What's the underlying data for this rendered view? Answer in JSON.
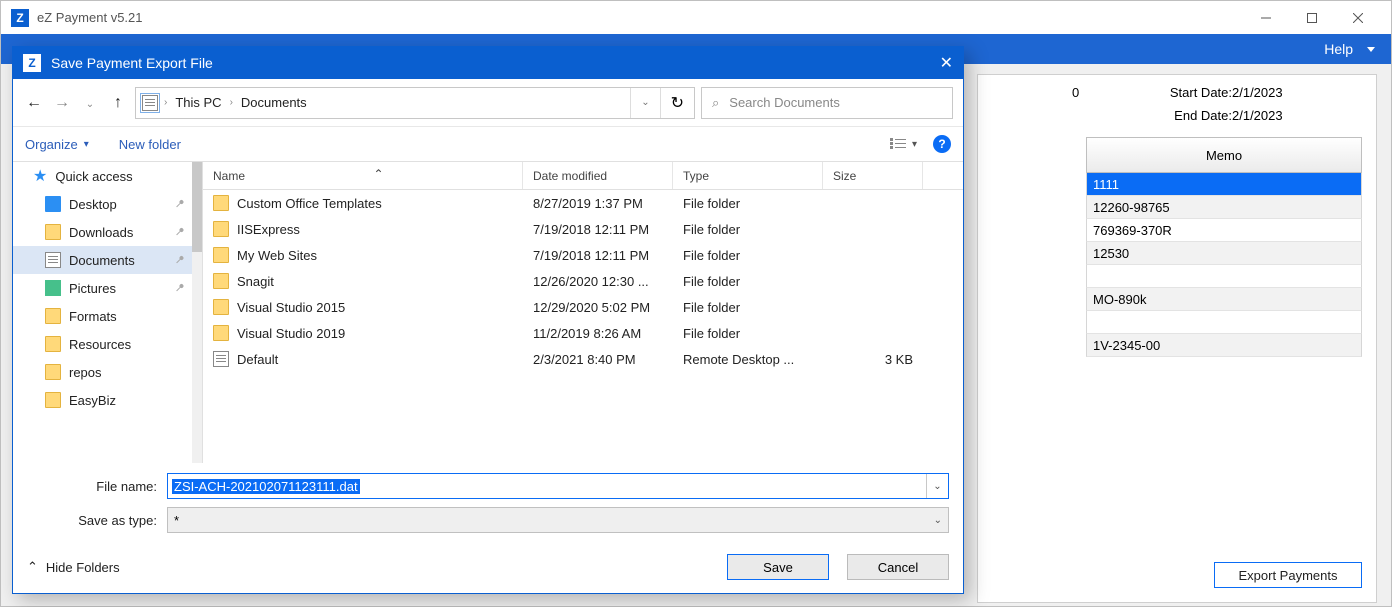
{
  "app": {
    "title": "eZ Payment v5.21",
    "menu": {
      "help": "Help"
    }
  },
  "right": {
    "zero": "0",
    "start_label": "Start Date:",
    "start_value": "2/1/2023",
    "end_label": "End Date:",
    "end_value": "2/1/2023",
    "memo_header": "Memo",
    "rows": [
      "1111",
      "12260-98765",
      "769369-370R",
      "12530",
      "",
      "MO-890k",
      "",
      "1V-2345-00"
    ],
    "export_label": "Export Payments"
  },
  "dialog": {
    "title": "Save Payment Export File",
    "breadcrumb": {
      "root": "This PC",
      "leaf": "Documents"
    },
    "search_placeholder": "Search Documents",
    "toolbar": {
      "organize": "Organize",
      "newfolder": "New folder"
    },
    "tree": {
      "quick": "Quick access",
      "items": [
        {
          "label": "Desktop",
          "icon": "desk",
          "pin": true
        },
        {
          "label": "Downloads",
          "icon": "dl",
          "pin": true
        },
        {
          "label": "Documents",
          "icon": "doc",
          "pin": true,
          "sel": true
        },
        {
          "label": "Pictures",
          "icon": "pic",
          "pin": true
        },
        {
          "label": "Formats",
          "icon": "folder"
        },
        {
          "label": "Resources",
          "icon": "folder"
        },
        {
          "label": "repos",
          "icon": "folder"
        },
        {
          "label": "EasyBiz",
          "icon": "folder"
        }
      ]
    },
    "columns": {
      "name": "Name",
      "date": "Date modified",
      "type": "Type",
      "size": "Size"
    },
    "files": [
      {
        "name": "Custom Office Templates",
        "date": "8/27/2019 1:37 PM",
        "type": "File folder",
        "size": "",
        "icon": "folder"
      },
      {
        "name": "IISExpress",
        "date": "7/19/2018 12:11 PM",
        "type": "File folder",
        "size": "",
        "icon": "folder"
      },
      {
        "name": "My Web Sites",
        "date": "7/19/2018 12:11 PM",
        "type": "File folder",
        "size": "",
        "icon": "folder"
      },
      {
        "name": "Snagit",
        "date": "12/26/2020 12:30 ...",
        "type": "File folder",
        "size": "",
        "icon": "folder"
      },
      {
        "name": "Visual Studio 2015",
        "date": "12/29/2020 5:02 PM",
        "type": "File folder",
        "size": "",
        "icon": "folder"
      },
      {
        "name": "Visual Studio 2019",
        "date": "11/2/2019 8:26 AM",
        "type": "File folder",
        "size": "",
        "icon": "folder"
      },
      {
        "name": "Default",
        "date": "2/3/2021 8:40 PM",
        "type": "Remote Desktop ...",
        "size": "3 KB",
        "icon": "rdp"
      }
    ],
    "filename_label": "File name:",
    "filename_value": "ZSI-ACH-202102071123111.dat",
    "saveastype_label": "Save as type:",
    "saveastype_value": "*",
    "hide_folders": "Hide Folders",
    "save": "Save",
    "cancel": "Cancel"
  }
}
